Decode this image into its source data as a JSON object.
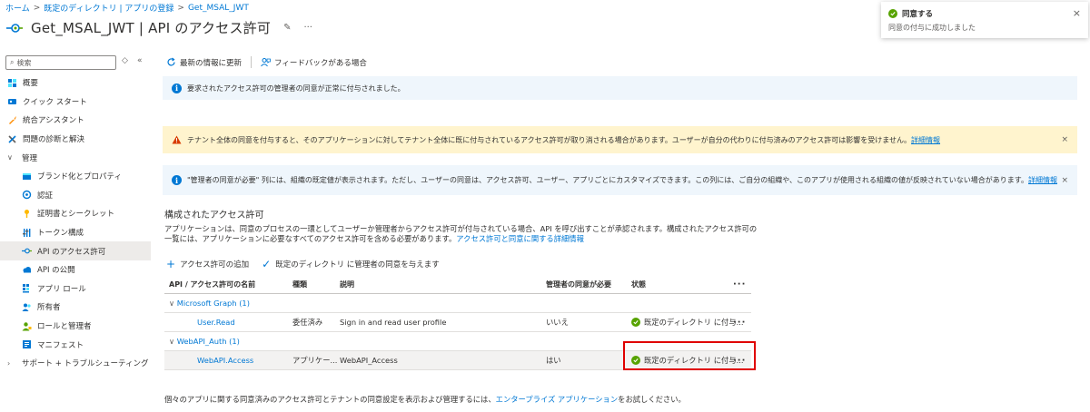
{
  "breadcrumb": {
    "items": [
      "ホーム",
      "既定のディレクトリ | アプリの登録",
      "Get_MSAL_JWT"
    ],
    "separator": ">"
  },
  "header": {
    "title": "Get_MSAL_JWT | API のアクセス許可",
    "pin_glyph": "✎",
    "more_glyph": "···"
  },
  "search": {
    "placeholder": "検索"
  },
  "nav": {
    "collapse_glyph": "«",
    "settings_glyph": "◇",
    "items": [
      {
        "label": "概要",
        "icon": "overview-icon"
      },
      {
        "label": "クイック スタート",
        "icon": "quickstart-icon"
      },
      {
        "label": "統合アシスタント",
        "icon": "rocket-icon"
      },
      {
        "label": "問題の診断と解決",
        "icon": "wrench-icon"
      },
      {
        "label": "管理",
        "icon": "chevron-down-icon"
      },
      {
        "label": "ブランド化とプロパティ",
        "icon": "branding-icon"
      },
      {
        "label": "認証",
        "icon": "auth-icon"
      },
      {
        "label": "証明書とシークレット",
        "icon": "key-icon"
      },
      {
        "label": "トークン構成",
        "icon": "token-icon"
      },
      {
        "label": "API のアクセス許可",
        "icon": "api-permission-icon"
      },
      {
        "label": "API の公開",
        "icon": "cloud-icon"
      },
      {
        "label": "アプリ ロール",
        "icon": "grid-icon"
      },
      {
        "label": "所有者",
        "icon": "owners-icon"
      },
      {
        "label": "ロールと管理者",
        "icon": "roles-icon"
      },
      {
        "label": "マニフェスト",
        "icon": "manifest-icon"
      },
      {
        "label": "サポート + トラブルシューティング",
        "icon": "chevron-right-icon"
      }
    ]
  },
  "toolbar": {
    "refresh_label": "最新の情報に更新",
    "feedback_label": "フィードバックがある場合"
  },
  "banners": {
    "success": "要求されたアクセス許可の管理者の同意が正常に付与されました。",
    "warning_text": "テナント全体の同意を付与すると、そのアプリケーションに対してテナント全体に既に付与されているアクセス許可が取り消される場合があります。ユーザーが自分の代わりに付与済みのアクセス許可は影響を受けません。",
    "warning_link": "詳細情報",
    "info_text": "\"管理者の同意が必要\" 列には、組織の既定値が表示されます。ただし、ユーザーの同意は、アクセス許可、ユーザー、アプリごとにカスタマイズできます。この列には、ご自分の組織や、このアプリが使用される組織の値が反映されていない場合があります。",
    "info_link": "詳細情報",
    "close_glyph": "×"
  },
  "section": {
    "title": "構成されたアクセス許可",
    "desc": "アプリケーションは、同意のプロセスの一環としてユーザーか管理者からアクセス許可が付与されている場合、API を呼び出すことが承認されます。構成されたアクセス許可の一覧には、アプリケーションに必要なすべてのアクセス許可を含める必要があります。",
    "desc_link": "アクセス許可と同意に関する詳細情報"
  },
  "actions": {
    "add_permission": "アクセス許可の追加",
    "grant_consent": "既定のディレクトリ に管理者の同意を与えます"
  },
  "table": {
    "headers": [
      "API / アクセス許可の名前",
      "種類",
      "説明",
      "管理者の同意が必要",
      "状態"
    ],
    "groups": [
      {
        "name": "Microsoft Graph (1)",
        "rows": [
          {
            "name": "User.Read",
            "type": "委任済み",
            "desc": "Sign in and read user profile",
            "admin": "いいえ",
            "status": "既定のディレクトリ に付与..."
          }
        ]
      },
      {
        "name": "WebAPI_Auth (1)",
        "rows": [
          {
            "name": "WebAPI.Access",
            "type": "アプリケー...",
            "desc": "WebAPI_Access",
            "admin": "はい",
            "status": "既定のディレクトリ に付与..."
          }
        ]
      }
    ],
    "more_glyph": "···"
  },
  "footer": {
    "text_before": "個々のアプリに関する同意済みのアクセス許可とテナントの同意設定を表示および管理するには、",
    "link": "エンタープライズ アプリケーション",
    "text_after": "をお試しください。"
  },
  "toast": {
    "title": "同意する",
    "message": "同意の付与に成功しました",
    "close_glyph": "×"
  },
  "colors": {
    "accent": "#0078d4",
    "success": "#57a300",
    "warning_bg": "#fff4ce",
    "info_bg": "#eff6fc",
    "highlight": "#e00000"
  }
}
